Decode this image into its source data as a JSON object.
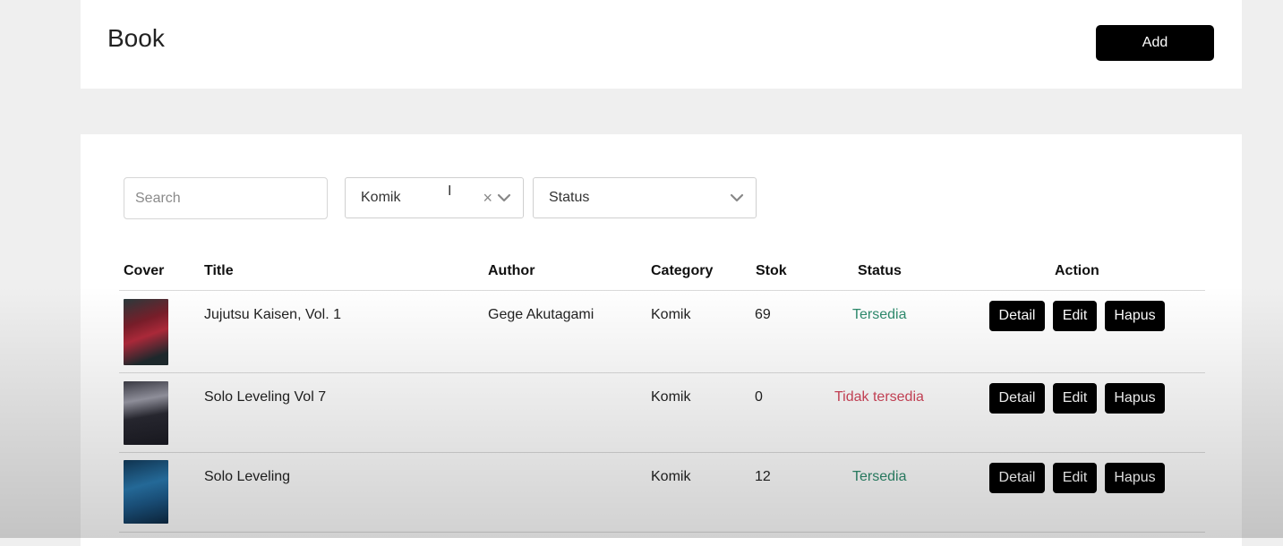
{
  "header": {
    "title": "Book",
    "add_label": "Add"
  },
  "filters": {
    "search_placeholder": "Search",
    "category_value": "Komik",
    "status_placeholder": "Status"
  },
  "table": {
    "columns": [
      "Cover",
      "Title",
      "Author",
      "Category",
      "Stok",
      "Status",
      "Action"
    ],
    "action_labels": {
      "detail": "Detail",
      "edit": "Edit",
      "delete": "Hapus"
    },
    "rows": [
      {
        "title": "Jujutsu Kaisen, Vol. 1",
        "author": "Gege Akutagami",
        "category": "Komik",
        "stok": "69",
        "status": "Tersedia"
      },
      {
        "title": "Solo Leveling Vol 7",
        "author": "",
        "category": "Komik",
        "stok": "0",
        "status": "Tidak tersedia"
      },
      {
        "title": "Solo Leveling",
        "author": "",
        "category": "Komik",
        "stok": "12",
        "status": "Tersedia"
      }
    ]
  },
  "colors": {
    "available": "#2e8b6d",
    "unavailable": "#d1455a",
    "button": "#000000",
    "background": "#efefef"
  },
  "icons": [
    "clear-icon",
    "chevron-down-icon",
    "text-cursor-icon",
    "book-cover-image"
  ]
}
